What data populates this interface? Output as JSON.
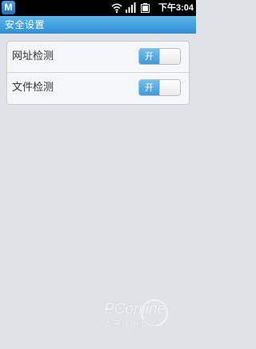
{
  "status_bar": {
    "app_icon": "M",
    "time": "下午3:04",
    "icons": [
      "wifi-icon",
      "signal-icon",
      "battery-icon"
    ]
  },
  "header": {
    "title": "安全设置"
  },
  "settings": [
    {
      "label": "网址检测",
      "toggle_label": "开",
      "state": "on"
    },
    {
      "label": "文件检测",
      "toggle_label": "开",
      "state": "on"
    }
  ],
  "watermark": {
    "brand": "PConline",
    "subtitle": "太平洋电脑网"
  },
  "colors": {
    "accent": "#3c9bdc",
    "title_bar": "#2d8fd6",
    "background": "#dfe3e7"
  }
}
